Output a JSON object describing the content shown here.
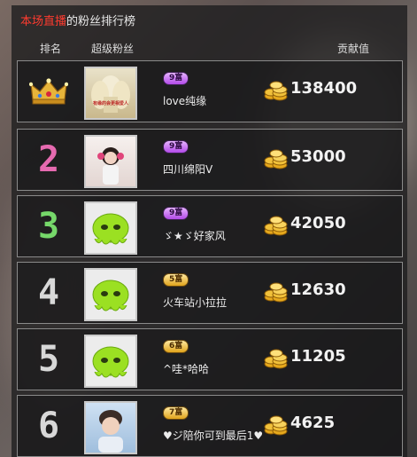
{
  "header": {
    "title_highlight": "本场直播",
    "title_rest": "的粉丝排行榜",
    "col_rank": "排名",
    "col_fan": "超级粉丝",
    "col_score": "贡献值"
  },
  "rows": [
    {
      "rank": "1",
      "rank_icon": "crown-icon",
      "badge": "9富",
      "badge_color": "purple",
      "name": "love纯缘",
      "score": "138400",
      "avatar_caption": "有缘的会更相爱人"
    },
    {
      "rank": "2",
      "rank_icon": "number",
      "rank_color": "#e66ab0",
      "badge": "9富",
      "badge_color": "purple",
      "name": "四川绵阳V",
      "score": "53000"
    },
    {
      "rank": "3",
      "rank_icon": "number",
      "rank_color": "#76d86a",
      "badge": "9富",
      "badge_color": "purple",
      "name": "ゞ★ゞ好家风",
      "score": "42050"
    },
    {
      "rank": "4",
      "rank_icon": "number",
      "rank_color": "#d8d8d8",
      "badge": "5富",
      "badge_color": "gold",
      "name": "火车站小拉拉",
      "score": "12630"
    },
    {
      "rank": "5",
      "rank_icon": "number",
      "rank_color": "#d8d8d8",
      "badge": "6富",
      "badge_color": "gold",
      "name": "^哇*哈哈",
      "score": "11205"
    },
    {
      "rank": "6",
      "rank_icon": "number",
      "rank_color": "#d8d8d8",
      "badge": "7富",
      "badge_color": "gold",
      "name": "♥ジ陪你可到最后1♥",
      "score": "4625"
    }
  ]
}
